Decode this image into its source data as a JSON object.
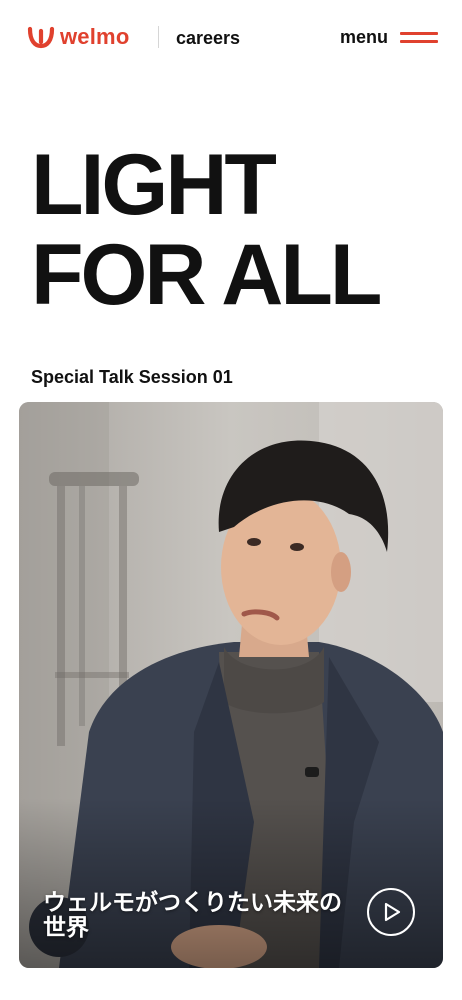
{
  "header": {
    "logo_text": "welmo",
    "section_label": "careers",
    "menu_label": "menu"
  },
  "hero": {
    "line1": "LIGHT",
    "line2": "FOR ALL"
  },
  "feature": {
    "session_label": "Special Talk Session 01",
    "video_caption": "ウェルモがつくりたい未来の世界",
    "play_icon": "play-icon"
  },
  "colors": {
    "brand": "#e0412e",
    "text": "#111111",
    "background": "#ffffff"
  }
}
